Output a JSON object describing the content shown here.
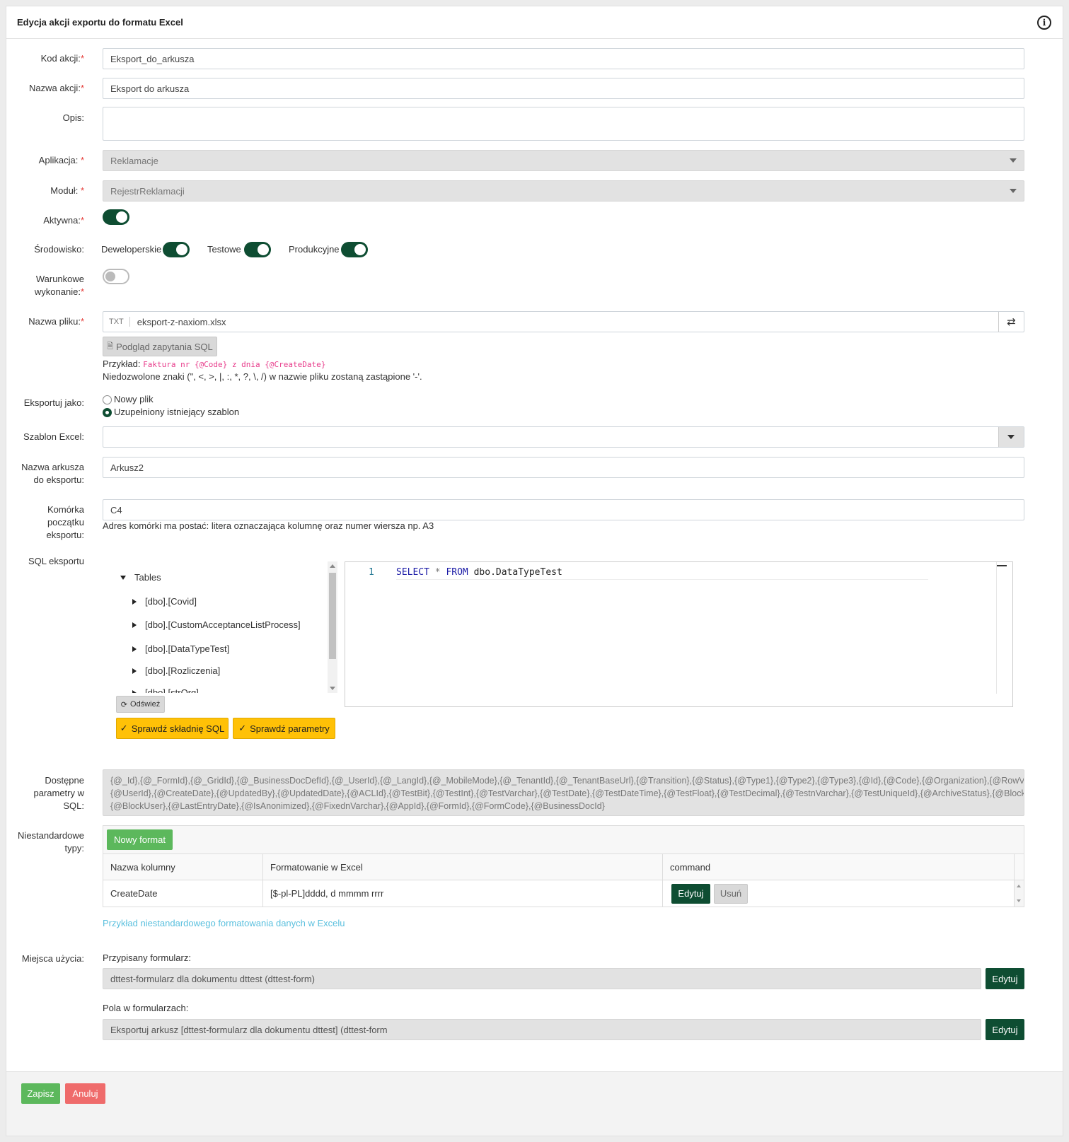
{
  "header": {
    "title": "Edycja akcji exportu do formatu Excel",
    "info_icon": "i"
  },
  "fields": {
    "kod_label": "Kod akcji:",
    "kod_value": "Eksport_do_arkusza",
    "nazwa_label": "Nazwa akcji:",
    "nazwa_value": "Eksport do arkusza",
    "opis_label": "Opis:",
    "opis_value": "",
    "aplikacja_label": "Aplikacja:",
    "aplikacja_value": "Reklamacje",
    "modul_label": "Moduł:",
    "modul_value": "RejestrReklamacji",
    "aktywna_label": "Aktywna:",
    "srodowisko_label": "Środowisko:",
    "env_dev": "Deweloperskie",
    "env_test": "Testowe",
    "env_prod": "Produkcyjne",
    "warunkowe_label_1": "Warunkowe",
    "warunkowe_label_2": "wykonanie:",
    "plik_label": "Nazwa pliku:",
    "plik_prefix": "TXT",
    "plik_value": "eksport-z-naxiom.xlsx",
    "preview_button": "Podgląd zapytania SQL",
    "example_label": "Przykład:",
    "example_code": "Faktura nr {@Code} z dnia {@CreateDate}",
    "forbidden_note": "Niedozwolone znaki (\", <, >, |, :, *, ?, \\, /) w nazwie pliku zostaną zastąpione '-'.",
    "eksportuj_label": "Eksportuj jako:",
    "radio_new": "Nowy plik",
    "radio_template": "Uzupełniony istniejący szablon",
    "szablon_label": "Szablon Excel:",
    "szablon_value": "",
    "arkusz_label_1": "Nazwa arkusza",
    "arkusz_label_2": "do eksportu:",
    "arkusz_value": "Arkusz2",
    "komorka_label_1": "Komórka",
    "komorka_label_2": "początku",
    "komorka_label_3": "eksportu:",
    "komorka_value": "C4",
    "komorka_note": "Adres komórki ma postać: litera oznaczająca kolumnę oraz numer wiersza np. A3",
    "sql_label": "SQL eksportu"
  },
  "sql": {
    "tree_root": "Tables",
    "tables": [
      "[dbo].[Covid]",
      "[dbo].[CustomAcceptanceListProcess]",
      "[dbo].[DataTypeTest]",
      "[dbo].[Rozliczenia]",
      "[dbo].[strOrg]"
    ],
    "refresh_button": "Odśwież",
    "check_syntax_button": "Sprawdź składnię SQL",
    "check_params_button": "Sprawdź parametry",
    "line_number": "1",
    "code_select": "SELECT",
    "code_star": " * ",
    "code_from": "FROM",
    "code_rest": " dbo.DataTypeTest"
  },
  "params": {
    "label_1": "Dostępne",
    "label_2": "parametry w",
    "label_3": "SQL:",
    "line1": "{@_Id},{@_FormId},{@_GridId},{@_BusinessDocDefId},{@_UserId},{@_LangId},{@_MobileMode},{@_TenantId},{@_TenantBaseUrl},{@Transition},{@Status},{@Type1},{@Type2},{@Type3},{@Id},{@Code},{@Organization},{@RowVersion},",
    "line2": "{@UserId},{@CreateDate},{@UpdatedBy},{@UpdatedDate},{@ACLId},{@TestBit},{@TestInt},{@TestVarchar},{@TestDate},{@TestDateTime},{@TestFloat},{@TestDecimal},{@TestnVarchar},{@TestUniqueId},{@ArchiveStatus},{@Blocked},",
    "line3": "{@BlockUser},{@LastEntryDate},{@IsAnonimized},{@FixednVarchar},{@AppId},{@FormId},{@FormCode},{@BusinessDocId}"
  },
  "custom_types": {
    "label_1": "Niestandardowe",
    "label_2": "typy:",
    "new_button": "Nowy format",
    "columns": [
      "Nazwa kolumny",
      "Formatowanie w Excel",
      "command"
    ],
    "rows": [
      {
        "name": "CreateDate",
        "format": "[$-pl-PL]dddd, d mmmm rrrr",
        "edit": "Edytuj",
        "delete": "Usuń"
      }
    ],
    "example_link": "Przykład niestandardowego formatowania danych w Excelu"
  },
  "usage": {
    "label": "Miejsca użycia:",
    "form_label": "Przypisany formularz:",
    "form_value": "dttest-formularz dla dokumentu dttest (dttest-form)",
    "form_edit": "Edytuj",
    "fields_label": "Pola w formularzach:",
    "fields_value": "Eksportuj arkusz [dttest-formularz dla dokumentu dttest] (dttest-form",
    "fields_edit": "Edytuj"
  },
  "footer": {
    "save": "Zapisz",
    "cancel": "Anuluj"
  }
}
